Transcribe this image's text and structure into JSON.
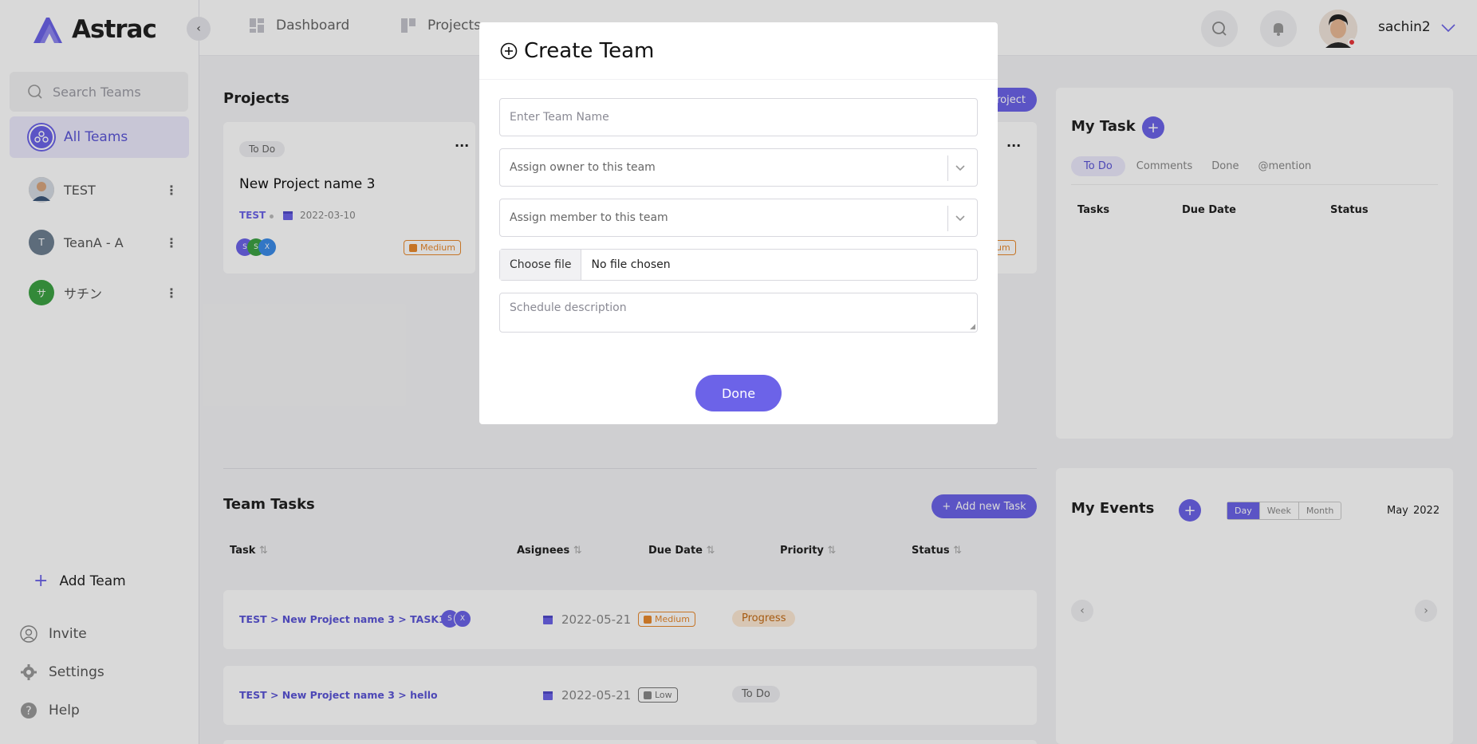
{
  "app": {
    "logo": "Astrac"
  },
  "sidebar": {
    "search_placeholder": "Search Teams",
    "items": [
      {
        "label": "All Teams"
      },
      {
        "label": "TEST"
      },
      {
        "label": "TeanA - A",
        "initial": "T"
      },
      {
        "label": "サチン",
        "initial": "サ"
      }
    ],
    "add_team": "Add Team",
    "invite": "Invite",
    "settings": "Settings",
    "help": "Help"
  },
  "topbar": {
    "nav": [
      "Dashboard",
      "Projects"
    ],
    "username": "sachin2"
  },
  "projects": {
    "title": "Projects",
    "new_button": "roject",
    "card": {
      "status": "To Do",
      "name": "New Project name 3",
      "team": "TEST",
      "date": "2022-03-10",
      "priority": "Medium",
      "members": [
        "S",
        "S",
        "X"
      ]
    },
    "card2_priority": "ium"
  },
  "team_tasks": {
    "title": "Team Tasks",
    "add_button": "Add new Task",
    "headers": [
      "Task",
      "Asignees",
      "Due Date",
      "Priority",
      "Status"
    ],
    "rows": [
      {
        "task": "TEST > New Project name 3 > TASK1",
        "assignees": [
          "S",
          "X"
        ],
        "due": "2022-05-21",
        "priority": "Medium",
        "status": "Progress"
      },
      {
        "task": "TEST > New Project name 3 > hello",
        "assignees": [],
        "due": "2022-05-21",
        "priority": "Low",
        "status": "To Do"
      }
    ]
  },
  "my_task": {
    "title": "My Task",
    "tabs": [
      "To Do",
      "Comments",
      "Done",
      "@mention"
    ],
    "columns": [
      "Tasks",
      "Due Date",
      "Status"
    ]
  },
  "my_events": {
    "title": "My Events",
    "views": [
      "Day",
      "Week",
      "Month"
    ],
    "month": "May",
    "year": "2022"
  },
  "modal": {
    "title": "Create Team",
    "team_name_placeholder": "Enter Team Name",
    "owner_placeholder": "Assign owner to this team",
    "member_placeholder": "Assign member to this team",
    "choose_file": "Choose file",
    "no_file": "No file chosen",
    "description_placeholder": "Schedule description",
    "done": "Done"
  },
  "colors": {
    "accent": "#6c63e8",
    "link": "#5b55d6",
    "medium": "#e8892d"
  }
}
